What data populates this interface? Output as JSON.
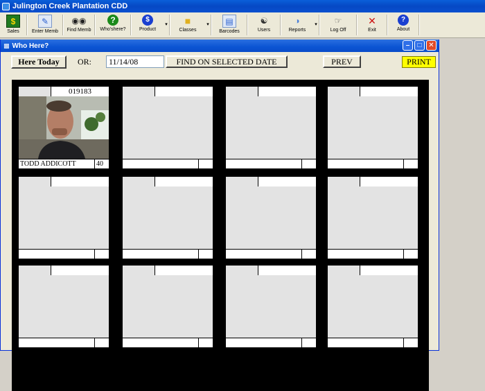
{
  "app": {
    "title": "Julington Creek Plantation CDD"
  },
  "toolbar": {
    "buttons": [
      {
        "label": "Sales",
        "icon": "sales-icon",
        "color": "#1f7a1f"
      },
      {
        "label": "Enter Memb",
        "icon": "enter-member-icon",
        "color": "#2a5fd0"
      },
      {
        "label": "Find Memb",
        "icon": "binoculars-icon",
        "color": "#222222"
      },
      {
        "label": "Who'shere?",
        "icon": "question-icon",
        "color": "#1a8a1a"
      },
      {
        "label": "Product",
        "icon": "product-icon",
        "color": "#1a3fd0"
      },
      {
        "label": "Classes",
        "icon": "folder-icon",
        "color": "#e0b020"
      },
      {
        "label": "Barcodes",
        "icon": "barcode-icon",
        "color": "#2a5fd0"
      },
      {
        "label": "Users",
        "icon": "users-icon",
        "color": "#333333"
      },
      {
        "label": "Reports",
        "icon": "reports-icon",
        "color": "#4a7fd8"
      },
      {
        "label": "Log Off",
        "icon": "log-off-icon",
        "color": "#555555"
      },
      {
        "label": "Exit",
        "icon": "exit-icon",
        "color": "#cc1010"
      },
      {
        "label": "About",
        "icon": "about-icon",
        "color": "#1a3fd0"
      }
    ]
  },
  "window": {
    "title": "Who Here?",
    "here_today_label": "Here Today",
    "or_label": "OR:",
    "date_value": "11/14/08",
    "find_label": "FIND ON SELECTED DATE",
    "prev_label": "PREV",
    "print_label": "PRINT"
  },
  "cards": [
    {
      "id": "019183",
      "name": "TODD ADDICOTT",
      "num": "40",
      "has_photo": true
    },
    {
      "id": "",
      "name": "",
      "num": "",
      "has_photo": false
    },
    {
      "id": "",
      "name": "",
      "num": "",
      "has_photo": false
    },
    {
      "id": "",
      "name": "",
      "num": "",
      "has_photo": false
    },
    {
      "id": "",
      "name": "",
      "num": "",
      "has_photo": false
    },
    {
      "id": "",
      "name": "",
      "num": "",
      "has_photo": false
    },
    {
      "id": "",
      "name": "",
      "num": "",
      "has_photo": false
    },
    {
      "id": "",
      "name": "",
      "num": "",
      "has_photo": false
    },
    {
      "id": "",
      "name": "",
      "num": "",
      "has_photo": false
    },
    {
      "id": "",
      "name": "",
      "num": "",
      "has_photo": false
    },
    {
      "id": "",
      "name": "",
      "num": "",
      "has_photo": false
    },
    {
      "id": "",
      "name": "",
      "num": "",
      "has_photo": false
    }
  ]
}
